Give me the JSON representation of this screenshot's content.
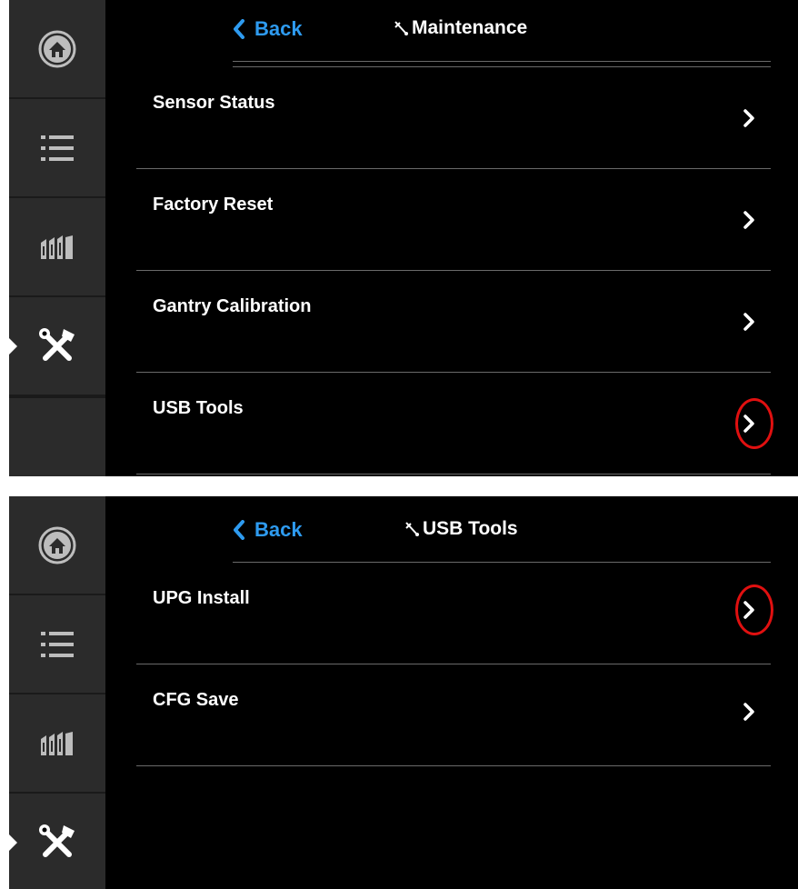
{
  "panel_1": {
    "header": {
      "back_label": "Back",
      "title": "Maintenance"
    },
    "sidebar": [
      "home-icon",
      "list-icon",
      "reagents-icon",
      "tools-icon"
    ],
    "items": [
      {
        "label": "Sensor Status"
      },
      {
        "label": "Factory Reset"
      },
      {
        "label": "Gantry Calibration"
      },
      {
        "label": "USB Tools",
        "highlighted": true
      }
    ]
  },
  "panel_2": {
    "header": {
      "back_label": "Back",
      "title": "USB Tools"
    },
    "sidebar": [
      "home-icon",
      "list-icon",
      "reagents-icon",
      "tools-icon"
    ],
    "items": [
      {
        "label": "UPG Install",
        "highlighted": true
      },
      {
        "label": "CFG Save"
      }
    ]
  },
  "colors": {
    "accent_blue": "#2e9bf0",
    "highlight_ring": "#e01010",
    "sidebar_bg": "#2b2b2b",
    "screen_bg": "#000000"
  }
}
